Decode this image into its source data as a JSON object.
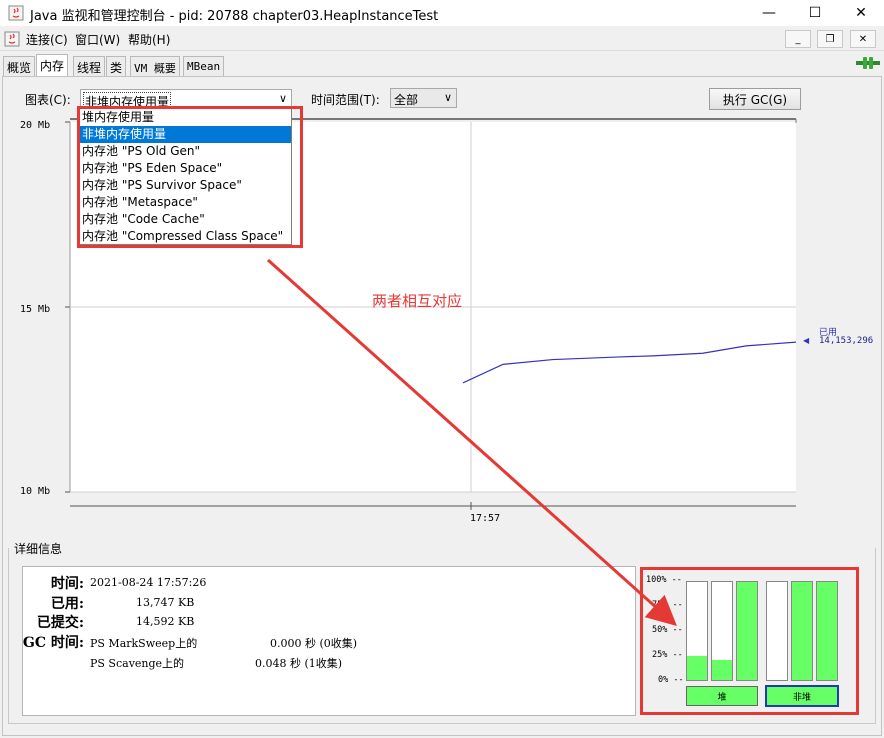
{
  "window": {
    "title": "Java 监视和管理控制台 - pid: 20788 chapter03.HeapInstanceTest",
    "minimize": "—",
    "maximize": "☐",
    "close": "✕"
  },
  "menubar": {
    "items": [
      "连接(C)",
      "窗口(W)",
      "帮助(H)"
    ],
    "mdi_minimize": "_",
    "mdi_restore": "❐",
    "mdi_close": "✕"
  },
  "tabs": [
    {
      "label": "概览",
      "active": false
    },
    {
      "label": "内存",
      "active": true
    },
    {
      "label": "线程",
      "active": false
    },
    {
      "label": "类",
      "active": false
    },
    {
      "label": "VM 概要",
      "active": false
    },
    {
      "label": "MBean",
      "active": false
    }
  ],
  "controls": {
    "chart_label": "图表(C):",
    "chart_selected": "非堆内存使用量",
    "time_range_label": "时间范围(T):",
    "time_range_selected": "全部",
    "gc_button": "执行 GC(G)"
  },
  "dropdown": {
    "options": [
      "堆内存使用量",
      "非堆内存使用量",
      "内存池 \"PS Old Gen\"",
      "内存池 \"PS Eden Space\"",
      "内存池 \"PS Survivor Space\"",
      "内存池 \"Metaspace\"",
      "内存池 \"Code Cache\"",
      "内存池 \"Compressed Class Space\""
    ],
    "selected_index": 1
  },
  "annotation": {
    "text": "两者相互对应",
    "color": "#e53935"
  },
  "chart_data": {
    "type": "line",
    "y_ticks": [
      "20 Mb",
      "15 Mb",
      "10 Mb"
    ],
    "x_ticks": [
      "17:57"
    ],
    "ylim": [
      10,
      20
    ],
    "series": [
      {
        "name": "已用",
        "color": "#3333bb",
        "points": [
          [
            0.0,
            12.95
          ],
          [
            0.12,
            13.45
          ],
          [
            0.27,
            13.58
          ],
          [
            0.47,
            13.65
          ],
          [
            0.57,
            13.68
          ],
          [
            0.72,
            13.75
          ],
          [
            0.85,
            13.95
          ],
          [
            1.0,
            14.05
          ]
        ]
      }
    ],
    "current_label": "已用",
    "current_value": "14,153,296"
  },
  "details": {
    "title": "详细信息",
    "rows": [
      {
        "key": "时间:",
        "value": "2021-08-24 17:57:26"
      },
      {
        "key": "已用:",
        "value": "13,747 KB"
      },
      {
        "key": "已提交:",
        "value": "14,592 KB"
      },
      {
        "key": "GC 时间:",
        "value": "PS MarkSweep上的",
        "value2": "0.000 秒 (0收集)"
      },
      {
        "key": "",
        "value": "PS Scavenge上的",
        "value2": "0.048 秒 (1收集)"
      }
    ]
  },
  "bars": {
    "pct_labels": [
      "100% --",
      "75% --",
      "50% --",
      "25% --",
      "0% --"
    ],
    "heap_fill": [
      0.24,
      0.2,
      1.0
    ],
    "nonheap_fill": [
      0.0,
      1.0,
      1.0
    ],
    "fill_color": "#66ff66",
    "heap_label": "堆",
    "nonheap_label": "非堆"
  }
}
